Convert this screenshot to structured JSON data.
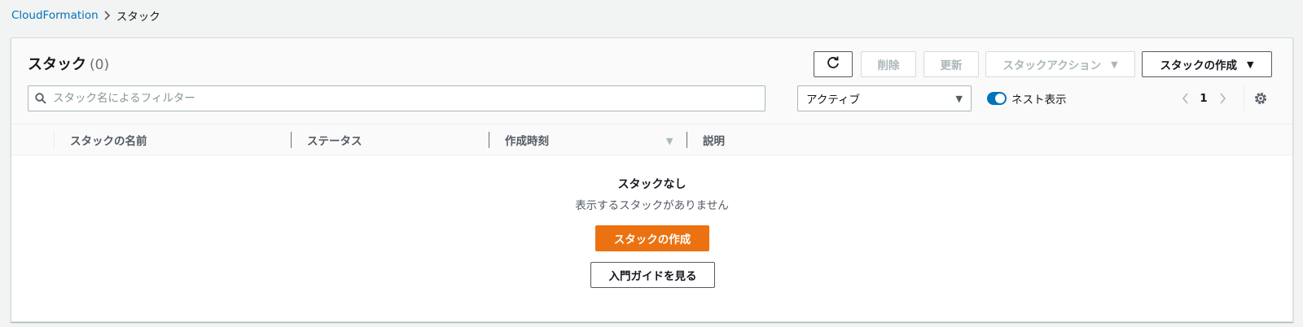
{
  "breadcrumb": {
    "root": "CloudFormation",
    "current": "スタック"
  },
  "panel": {
    "title": "スタック",
    "count": "(0)"
  },
  "toolbar": {
    "refresh_icon": "refresh-icon",
    "delete_label": "削除",
    "update_label": "更新",
    "actions_label": "スタックアクション",
    "create_label": "スタックの作成"
  },
  "filter": {
    "placeholder": "スタック名によるフィルター",
    "value": ""
  },
  "status_select": {
    "selected": "アクティブ"
  },
  "nested_toggle": {
    "label": "ネスト表示",
    "on": true
  },
  "pagination": {
    "current_page": "1"
  },
  "table": {
    "columns": [
      "スタックの名前",
      "ステータス",
      "作成時刻",
      "説明"
    ]
  },
  "empty_state": {
    "title": "スタックなし",
    "message": "表示するスタックがありません",
    "create_button": "スタックの作成",
    "guide_button": "入門ガイドを見る"
  },
  "colors": {
    "accent": "#0073bb",
    "primary_button": "#ec7211",
    "background": "#f2f3f3"
  }
}
